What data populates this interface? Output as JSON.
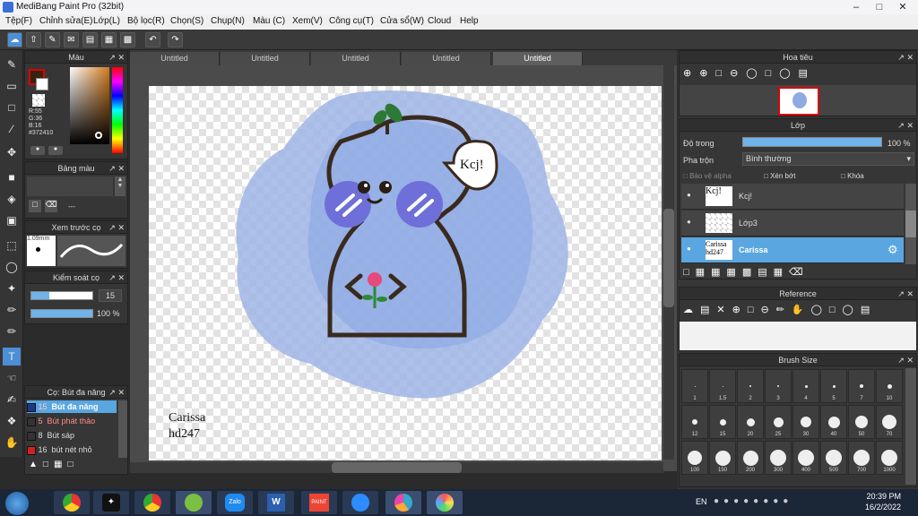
{
  "app": {
    "title": "MediBang Paint Pro (32bit)"
  },
  "menu": [
    "Tệp(F)",
    "Chỉnh sửa(E)",
    "Lớp(L)",
    "Bộ lọc(R)",
    "Chọn(S)",
    "Chụp(N)",
    "Màu (C)",
    "Xem(V)",
    "Công cụ(T)",
    "Cửa sổ(W)",
    "Cloud",
    "Help"
  ],
  "tabs": [
    "Untitled",
    "Untitled",
    "Untitled",
    "Untitled",
    "Untitled"
  ],
  "color_panel": {
    "title": "Màu",
    "r": "R:55",
    "g": "G:36",
    "b": "B:16",
    "hex": "#372410",
    "primary": "#372410"
  },
  "palette_panel": {
    "title": "Bảng màu",
    "value": "---"
  },
  "brush_preview": {
    "title": "Xem trước cọ",
    "size": "1.09mm"
  },
  "brush_control": {
    "title": "Kiểm soát cọ",
    "size": "15",
    "opacity": "100 %"
  },
  "brush_list": {
    "title": "Cọ: Bút đa năng",
    "items": [
      {
        "size": "15",
        "name": "Bút đa năng",
        "color": "#1b3a8a"
      },
      {
        "size": "5",
        "name": "Bút phát thảo",
        "color": "#333"
      },
      {
        "size": "8",
        "name": "Bút sáp",
        "color": "#333"
      },
      {
        "size": "16",
        "name": "bút nét nhỏ",
        "color": "#d42020"
      }
    ]
  },
  "navigator": {
    "title": "Hoa tiêu"
  },
  "layer_panel": {
    "title": "Lớp",
    "opacity_label": "Độ trong",
    "opacity_value": "100 %",
    "blend_label": "Pha trộn",
    "blend_value": "Bình thường",
    "protect_alpha": "Bảo vệ alpha",
    "clipping": "Xén bớt",
    "lock": "Khóa",
    "layers": [
      {
        "name": "Kcj!",
        "thumb": "Kcj!"
      },
      {
        "name": "Lớp3",
        "thumb": ""
      },
      {
        "name": "Carissa",
        "thumb": "Carissa hd247"
      }
    ]
  },
  "reference": {
    "title": "Reference"
  },
  "brush_size": {
    "title": "Brush Size",
    "sizes": [
      "1",
      "1.5",
      "2",
      "3",
      "4",
      "5",
      "7",
      "10",
      "12",
      "15",
      "20",
      "25",
      "30",
      "40",
      "50",
      "70",
      "100",
      "150",
      "200",
      "300",
      "400",
      "500",
      "700",
      "1000"
    ]
  },
  "canvas": {
    "bubble_text": "Kcj!",
    "sign_line1": "Carissa",
    "sign_line2": "hd247"
  },
  "taskbar": {
    "lang": "EN",
    "time": "20:39 PM",
    "date": "16/2/2022"
  }
}
